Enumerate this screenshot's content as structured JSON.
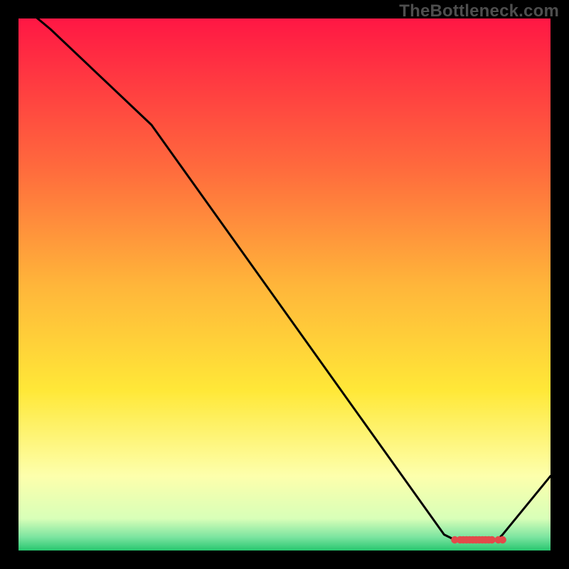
{
  "watermark": "TheBottleneck.com",
  "colors": {
    "background": "#000000",
    "line": "#000000",
    "marker": "#e24a4a",
    "gradient_top": "#ff1744",
    "gradient_mid_top": "#ff8a3d",
    "gradient_mid": "#ffe838",
    "gradient_low": "#f8ffb0",
    "gradient_bottom": "#28c76f"
  },
  "chart_data": {
    "type": "line",
    "title": "",
    "xlabel": "",
    "ylabel": "",
    "xlim": [
      0,
      100
    ],
    "ylim": [
      0,
      100
    ],
    "x": [
      0,
      6,
      25,
      80,
      82,
      83,
      84,
      85,
      86,
      87,
      88,
      89,
      90,
      91,
      100
    ],
    "values": [
      103,
      98,
      80,
      3,
      2,
      2,
      2,
      2,
      2,
      2,
      2,
      2,
      2,
      3,
      14
    ],
    "marker_points_x": [
      82,
      83,
      83.6,
      84.2,
      84.8,
      85.4,
      86,
      86.6,
      87.2,
      87.8,
      88.4,
      89,
      90.2,
      91
    ],
    "grid": false,
    "legend": false
  }
}
